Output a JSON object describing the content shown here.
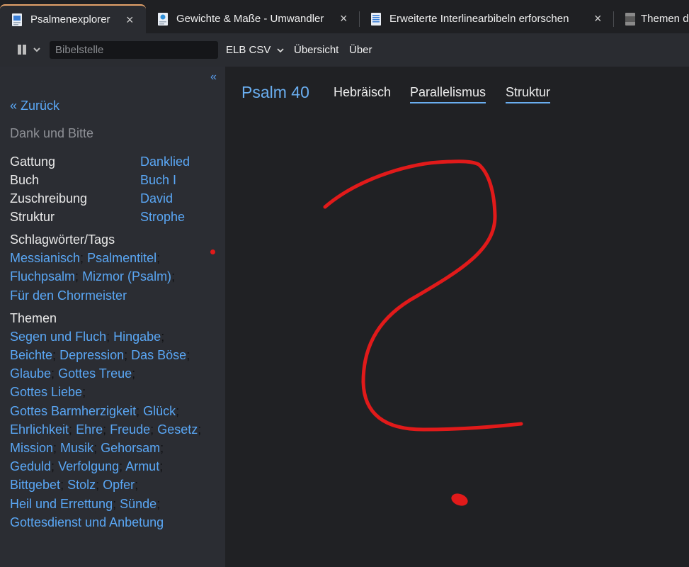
{
  "tabs": [
    {
      "label": "Psalmenexplorer",
      "active": true,
      "close": "×"
    },
    {
      "label": "Gewichte & Maße - Umwandler",
      "active": false,
      "close": "×"
    },
    {
      "label": "Erweiterte Interlinearbibeln erforschen",
      "active": false,
      "close": "×"
    },
    {
      "label": "Themen de",
      "active": false
    }
  ],
  "toolbar": {
    "search_placeholder": "Bibelstelle",
    "bible_version": "ELB CSV",
    "overview_label": "Übersicht",
    "about_label": "Über"
  },
  "sidebar": {
    "collapse": "«",
    "back_label": "« Zurück",
    "subtitle": "Dank und Bitte",
    "properties": [
      {
        "label": "Gattung",
        "value": "Danklied"
      },
      {
        "label": "Buch",
        "value": "Buch I"
      },
      {
        "label": "Zuschreibung",
        "value": "David"
      },
      {
        "label": "Struktur",
        "value": "Strophe"
      }
    ],
    "tags_title": "Schlagwörter/Tags",
    "tags": [
      "Messianisch",
      "Psalmentitel",
      "Fluchpsalm",
      "Mizmor (Psalm)",
      "Für den Chormeister"
    ],
    "themes_title": "Themen",
    "themes": [
      "Segen und Fluch",
      "Hingabe",
      "Beichte",
      "Depression",
      "Das Böse",
      "Glaube",
      "Gottes Treue",
      "Gottes Liebe",
      "Gottes Barmherzigkeit",
      "Glück",
      "Ehrlichkeit",
      "Ehre",
      "Freude",
      "Gesetz",
      "Mission",
      "Musik",
      "Gehorsam",
      "Geduld",
      "Verfolgung",
      "Armut",
      "Bittgebet",
      "Stolz",
      "Opfer",
      "Heil und Errettung",
      "Sünde",
      "Gottesdienst und Anbetung"
    ],
    "separator": ";"
  },
  "main": {
    "title": "Psalm 40",
    "tabs": [
      "Hebräisch",
      "Parallelismus",
      "Struktur"
    ]
  },
  "colors": {
    "accent": "#5aa7f5",
    "tab_active_border": "#e3a26a",
    "annotation_red": "#e11a1a"
  }
}
